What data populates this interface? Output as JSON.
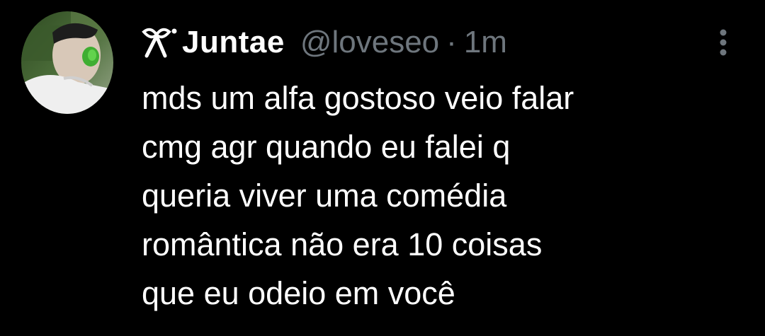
{
  "tweet": {
    "display_name": "Juntae",
    "handle": "@loveseo",
    "separator": "·",
    "time": "1m",
    "text_lines": [
      "mds um alfa gostoso veio falar",
      "cmg agr quando eu falei q",
      "queria viver uma comédia",
      "romântica não era 10 coisas",
      "que eu odeio em você"
    ],
    "icons": {
      "name_prefix": "bow-icon",
      "menu": "more-vertical-icon"
    }
  },
  "colors": {
    "background": "#000000",
    "text": "#ffffff",
    "muted": "#6e767d"
  }
}
